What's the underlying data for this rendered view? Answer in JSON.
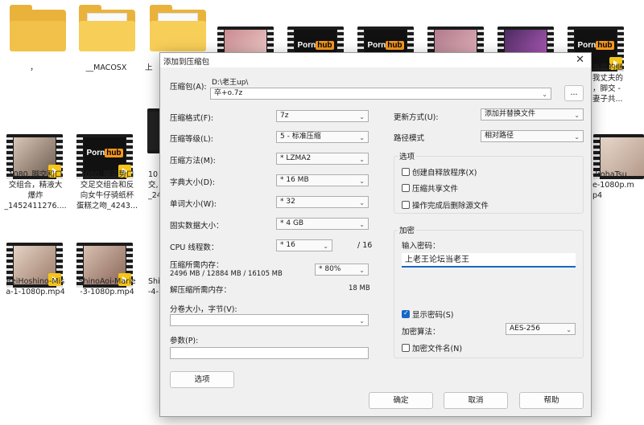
{
  "explorer": {
    "folders": [
      {
        "label": "，"
      },
      {
        "label": "__MACOSX"
      },
      {
        "label": "上"
      }
    ],
    "top_videos": [
      {
        "brand": ""
      },
      {
        "brand_a": "Porn",
        "brand_b": "hub"
      },
      {
        "brand_a": "Porn",
        "brand_b": "hub"
      },
      {
        "brand": ""
      },
      {
        "brand": ""
      },
      {
        "brand_a": "Porn",
        "brand_b": "hub"
      }
    ],
    "right_top_label": "当我的继\n我丈夫的\n，脚交 -\n妻子共...",
    "middle_row": [
      {
        "label": "1080_脚交和口\n交组合，精液大\n爆炸\n_1452411276...."
      },
      {
        "label": "1080_脚姿势口\n交足交组合和反\n向女牛仔骑纸杯\n蛋糕之吻_4243...",
        "brand_a": "Porn",
        "brand_b": "hub"
      },
      {
        "label": "10\n交,\n_24"
      }
    ],
    "right_mid_label": "-IrohaTsu\ne-1080p.m\np4",
    "bottom_row": [
      {
        "label": "ReiHoshino-Mis\na-1-1080p.mp4"
      },
      {
        "label": "ShinoAoi-Marie\n-3-1080p.mp4"
      },
      {
        "label": "Shi\n-4-"
      }
    ]
  },
  "dialog": {
    "title": "添加到压缩包",
    "archive_label": "压缩包(A):",
    "archive_path": "D:\\老王up\\",
    "archive_name": "卒+o.7z",
    "browse_label": "...",
    "format_label": "压缩格式(F):",
    "format_value": "7z",
    "level_label": "压缩等级(L):",
    "level_value": "5 - 标准压缩",
    "method_label": "压缩方法(M):",
    "method_value": "* LZMA2",
    "dict_label": "字典大小(D):",
    "dict_value": "* 16 MB",
    "word_label": "单词大小(W):",
    "word_value": "* 32",
    "solid_label": "固实数据大小：",
    "solid_value": "* 4 GB",
    "cpu_label": "CPU 线程数：",
    "cpu_value": "* 16",
    "cpu_total": "/ 16",
    "mem_comp_label": "压缩所需内存：",
    "mem_comp_detail": "2496 MB / 12884 MB / 16105 MB",
    "mem_comp_value": "* 80%",
    "mem_decomp_label": "解压缩所需内存：",
    "mem_decomp_value": "18 MB",
    "split_label": "分卷大小，字节(V):",
    "split_value": "",
    "params_label": "参数(P):",
    "params_value": "",
    "options_button": "选项",
    "update_label": "更新方式(U):",
    "update_value": "添加并替换文件",
    "path_label": "路径模式",
    "path_value": "相对路径",
    "options_group": "选项",
    "opt_sfx": "创建自释放程序(X)",
    "opt_shared": "压缩共享文件",
    "opt_delete": "操作完成后删除源文件",
    "encrypt_group": "加密",
    "password_label": "输入密码：",
    "password_value": "上老王论坛当老王",
    "show_password": "显示密码(S)",
    "enc_method_label": "加密算法：",
    "enc_method_value": "AES-256",
    "encrypt_names": "加密文件名(N)",
    "ok": "确定",
    "cancel": "取消",
    "help": "帮助"
  },
  "colors": {
    "accent": "#1667c5",
    "folder": "#f7ce58",
    "dialog_bg": "#f0f0f0",
    "pornhub_orange": "#f7971d"
  }
}
